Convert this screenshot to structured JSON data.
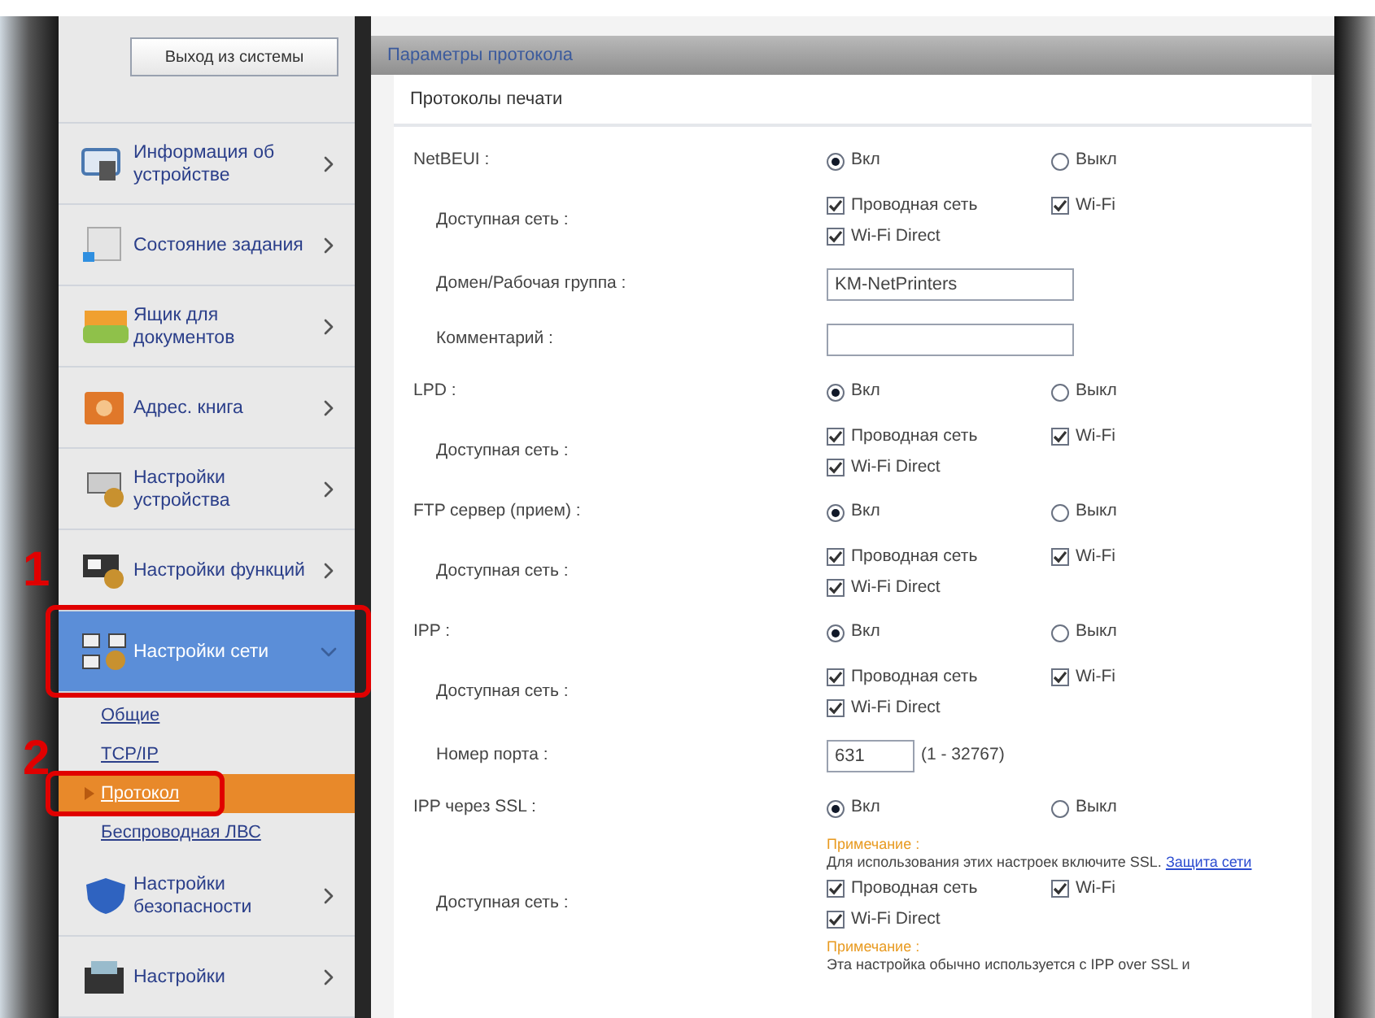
{
  "logout_button": "Выход из системы",
  "sidebar": {
    "items": [
      {
        "label": "Информация об устройстве",
        "selected": false,
        "expanded": false,
        "highlighted": false
      },
      {
        "label": "Состояние задания",
        "selected": false,
        "expanded": false,
        "highlighted": false
      },
      {
        "label": "Ящик для документов",
        "selected": false,
        "expanded": false,
        "highlighted": false
      },
      {
        "label": "Адрес. книга",
        "selected": false,
        "expanded": false,
        "highlighted": false
      },
      {
        "label": "Настройки устройства",
        "selected": false,
        "expanded": false,
        "highlighted": false
      },
      {
        "label": "Настройки функций",
        "selected": false,
        "expanded": false,
        "highlighted": false
      },
      {
        "label": "Настройки сети",
        "selected": true,
        "expanded": true,
        "highlighted": true,
        "children": [
          {
            "label": "Общие",
            "selected": false,
            "highlighted": false
          },
          {
            "label": "TCP/IP",
            "selected": false,
            "highlighted": false
          },
          {
            "label": "Протокол",
            "selected": true,
            "highlighted": true
          },
          {
            "label": "Беспроводная ЛВС",
            "selected": false,
            "highlighted": false
          }
        ]
      },
      {
        "label": "Настройки безопасности",
        "selected": false,
        "expanded": false,
        "highlighted": false
      },
      {
        "label": "Настройки",
        "selected": false,
        "expanded": false,
        "highlighted": false
      }
    ]
  },
  "step_markers": [
    "1",
    "2"
  ],
  "panel": {
    "title": "Параметры протокола",
    "section": "Протоколы печати",
    "rows": [
      {
        "kind": "radio",
        "label": "NetBEUI :",
        "options": [
          {
            "label": "Вкл",
            "selected": true
          },
          {
            "label": "Выкл",
            "selected": false
          }
        ]
      },
      {
        "kind": "networks",
        "label": "Доступная сеть :",
        "checks": [
          {
            "label": "Проводная сеть",
            "checked": true
          },
          {
            "label": "Wi-Fi",
            "checked": true
          },
          {
            "label": "Wi-Fi Direct",
            "checked": true
          }
        ]
      },
      {
        "kind": "text",
        "label": "Домен/Рабочая группа :",
        "value": "KM-NetPrinters"
      },
      {
        "kind": "text",
        "label": "Комментарий :"
      },
      {
        "kind": "radio",
        "label": "LPD :",
        "options": [
          {
            "label": "Вкл",
            "selected": true
          },
          {
            "label": "Выкл",
            "selected": false
          }
        ]
      },
      {
        "kind": "networks",
        "label": "Доступная сеть :",
        "checks": [
          {
            "label": "Проводная сеть",
            "checked": true
          },
          {
            "label": "Wi-Fi",
            "checked": true
          },
          {
            "label": "Wi-Fi Direct",
            "checked": true
          }
        ]
      },
      {
        "kind": "radio",
        "label": "FTP сервер (прием) :",
        "options": [
          {
            "label": "Вкл",
            "selected": true
          },
          {
            "label": "Выкл",
            "selected": false
          }
        ]
      },
      {
        "kind": "networks",
        "label": "Доступная сеть :",
        "checks": [
          {
            "label": "Проводная сеть",
            "checked": true
          },
          {
            "label": "Wi-Fi",
            "checked": true
          },
          {
            "label": "Wi-Fi Direct",
            "checked": true
          }
        ]
      },
      {
        "kind": "radio",
        "label": "IPP :",
        "options": [
          {
            "label": "Вкл",
            "selected": true
          },
          {
            "label": "Выкл",
            "selected": false
          }
        ]
      },
      {
        "kind": "networks",
        "label": "Доступная сеть :",
        "checks": [
          {
            "label": "Проводная сеть",
            "checked": true
          },
          {
            "label": "Wi-Fi",
            "checked": true
          },
          {
            "label": "Wi-Fi Direct",
            "checked": true
          }
        ]
      },
      {
        "kind": "port",
        "label": "Номер порта :",
        "value": "631",
        "range": "(1 - 32767)"
      },
      {
        "kind": "radio",
        "label": "IPP через SSL :",
        "options": [
          {
            "label": "Вкл",
            "selected": true
          },
          {
            "label": "Выкл",
            "selected": false
          }
        ]
      },
      {
        "kind": "networks",
        "label": "Доступная сеть :",
        "note_before": {
          "title": "Примечание :",
          "text": "Для использования этих настроек включите SSL.",
          "link": "Защита сети"
        },
        "checks": [
          {
            "label": "Проводная сеть",
            "checked": true
          },
          {
            "label": "Wi-Fi",
            "checked": true
          },
          {
            "label": "Wi-Fi Direct",
            "checked": true
          }
        ],
        "note_after": {
          "title": "Примечание :",
          "text": "Эта настройка обычно используется с IPP over SSL и"
        }
      }
    ]
  }
}
